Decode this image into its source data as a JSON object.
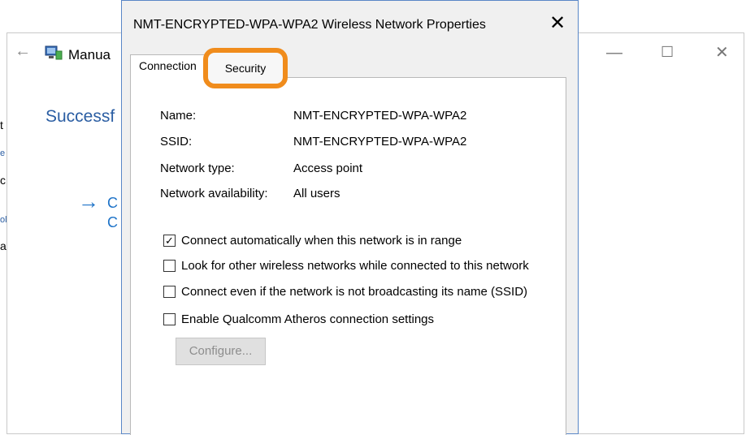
{
  "background_window": {
    "title": "Manua",
    "heading": "Successf",
    "link_line1": "C",
    "link_line2": "C",
    "edge_chars": [
      "t",
      "e",
      "c",
      "ol",
      "ai"
    ]
  },
  "dialog": {
    "title": "NMT-ENCRYPTED-WPA-WPA2 Wireless Network Properties",
    "tabs": [
      {
        "label": "Connection",
        "selected": true
      },
      {
        "label": "Security",
        "highlighted": true
      }
    ],
    "properties": [
      {
        "label": "Name:",
        "value": "NMT-ENCRYPTED-WPA-WPA2"
      },
      {
        "label": "SSID:",
        "value": "NMT-ENCRYPTED-WPA-WPA2"
      },
      {
        "label": "Network type:",
        "value": "Access point"
      },
      {
        "label": "Network availability:",
        "value": "All users"
      }
    ],
    "checkboxes": [
      {
        "label": "Connect automatically when this network is in range",
        "checked": true
      },
      {
        "label": "Look for other wireless networks while connected to this network",
        "checked": false
      },
      {
        "label": "Connect even if the network is not broadcasting its name (SSID)",
        "checked": false
      },
      {
        "label": "Enable Qualcomm Atheros connection settings",
        "checked": false
      }
    ],
    "configure_button": "Configure...",
    "highlight_color": "#f08c1c"
  }
}
